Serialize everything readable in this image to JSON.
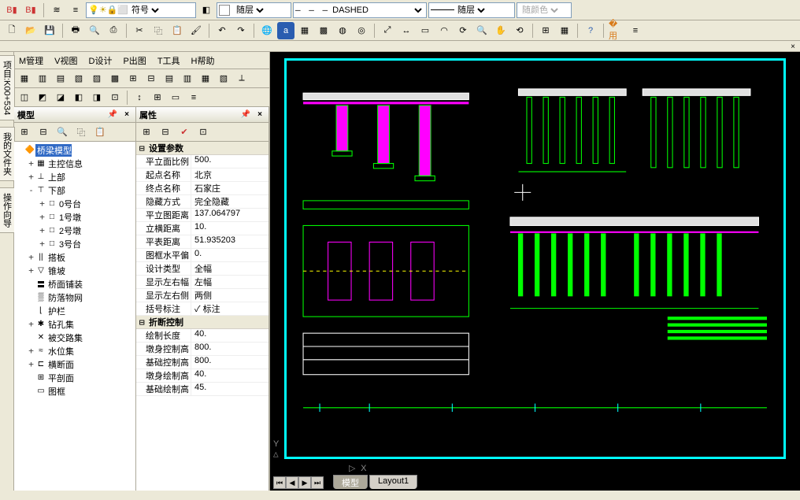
{
  "top_toolbar": {
    "symbol_combo": "符号",
    "layer_combo": "随层",
    "linetype_combo": "DASHED",
    "lineweight_combo": "随层",
    "color_combo": "随颜色"
  },
  "menus": [
    "M管理",
    "V视图",
    "D设计",
    "P出图",
    "T工具",
    "H帮助"
  ],
  "side_tabs": [
    "项目:K00+534",
    "我的文件夹",
    "操作向导"
  ],
  "tree_panel": {
    "title": "模型",
    "nodes": [
      {
        "depth": 0,
        "tw": "",
        "ic": "🔶",
        "label": "桥梁模型",
        "sel": true
      },
      {
        "depth": 1,
        "tw": "+",
        "ic": "▦",
        "label": "主控信息"
      },
      {
        "depth": 1,
        "tw": "+",
        "ic": "⊥",
        "label": "上部"
      },
      {
        "depth": 1,
        "tw": "-",
        "ic": "⊤",
        "label": "下部"
      },
      {
        "depth": 2,
        "tw": "+",
        "ic": "□",
        "label": "0号台"
      },
      {
        "depth": 2,
        "tw": "+",
        "ic": "□",
        "label": "1号墩"
      },
      {
        "depth": 2,
        "tw": "+",
        "ic": "□",
        "label": "2号墩"
      },
      {
        "depth": 2,
        "tw": "+",
        "ic": "□",
        "label": "3号台"
      },
      {
        "depth": 1,
        "tw": "+",
        "ic": "||",
        "label": "搭板"
      },
      {
        "depth": 1,
        "tw": "+",
        "ic": "▽",
        "label": "锥坡"
      },
      {
        "depth": 1,
        "tw": "",
        "ic": "〓",
        "label": "桥面铺装"
      },
      {
        "depth": 1,
        "tw": "",
        "ic": "▒",
        "label": "防落物网"
      },
      {
        "depth": 1,
        "tw": "",
        "ic": "⌊",
        "label": "护栏"
      },
      {
        "depth": 1,
        "tw": "+",
        "ic": "✱",
        "label": "钻孔集"
      },
      {
        "depth": 1,
        "tw": "",
        "ic": "✕",
        "label": "被交路集"
      },
      {
        "depth": 1,
        "tw": "+",
        "ic": "≈",
        "label": "水位集"
      },
      {
        "depth": 1,
        "tw": "+",
        "ic": "⊏",
        "label": "横断面"
      },
      {
        "depth": 1,
        "tw": "",
        "ic": "⊞",
        "label": "平剖面"
      },
      {
        "depth": 1,
        "tw": "",
        "ic": "▭",
        "label": "图框"
      }
    ]
  },
  "prop_panel": {
    "title": "属性",
    "groups": [
      {
        "name": "设置参数",
        "rows": [
          {
            "k": "平立面比例",
            "v": "500."
          },
          {
            "k": "起点名称",
            "v": "北京"
          },
          {
            "k": "终点名称",
            "v": "石家庄"
          },
          {
            "k": "隐藏方式",
            "v": "完全隐藏"
          },
          {
            "k": "平立图距离",
            "v": "137.064797"
          },
          {
            "k": "立横距离",
            "v": "10."
          },
          {
            "k": "平表距离",
            "v": "51.935203"
          },
          {
            "k": "图框水平偏",
            "v": "0."
          },
          {
            "k": "设计类型",
            "v": "全幅"
          },
          {
            "k": "显示左右幅",
            "v": "左幅"
          },
          {
            "k": "显示左右侧",
            "v": "两侧"
          },
          {
            "k": "括号标注",
            "v": "✓ 标注"
          }
        ]
      },
      {
        "name": "折断控制",
        "rows": [
          {
            "k": "绘制长度",
            "v": "40."
          },
          {
            "k": "墩身控制高",
            "v": "800."
          },
          {
            "k": "基础控制高",
            "v": "800."
          },
          {
            "k": "墩身绘制高",
            "v": "40."
          },
          {
            "k": "基础绘制高",
            "v": "45."
          }
        ]
      }
    ]
  },
  "bottom_tabs": [
    "模型",
    "Layout1"
  ],
  "axis": {
    "x": "X",
    "y": "Y",
    "arrow": "▷"
  }
}
